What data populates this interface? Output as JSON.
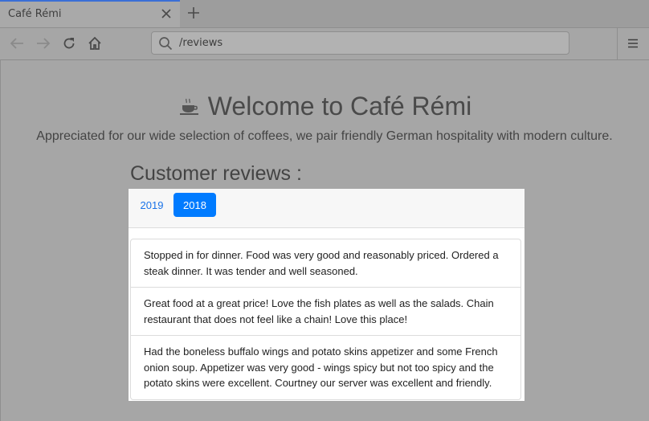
{
  "browser": {
    "tab_title": "Café Rémi",
    "url": "/reviews"
  },
  "hero": {
    "title": "Welcome to Café Rémi",
    "subtitle": "Appreciated for our wide selection of coffees, we pair friendly German hospitality with modern culture."
  },
  "reviews": {
    "heading": "Customer reviews :",
    "tabs": [
      {
        "label": "2019",
        "active": false
      },
      {
        "label": "2018",
        "active": true
      }
    ],
    "items": [
      "Stopped in for dinner. Food was very good and reasonably priced. Ordered a steak dinner. It was tender and well seasoned.",
      "Great food at a great price! Love the fish plates as well as the salads. Chain restaurant that does not feel like a chain! Love this place!",
      "Had the boneless buffalo wings and potato skins appetizer and some French onion soup. Appetizer was very good - wings spicy but not too spicy and the potato skins were excellent. Courtney our server was excellent and friendly."
    ]
  },
  "colors": {
    "accent": "#007bff",
    "tab_indicator": "#3b6fd6"
  },
  "icons": {
    "tab_close": "close-icon",
    "new_tab": "plus-icon",
    "back": "back-arrow-icon",
    "forward": "forward-arrow-icon",
    "reload": "reload-icon",
    "home": "home-icon",
    "search": "search-icon",
    "menu": "hamburger-menu-icon",
    "brand": "coffee-cup-icon"
  }
}
